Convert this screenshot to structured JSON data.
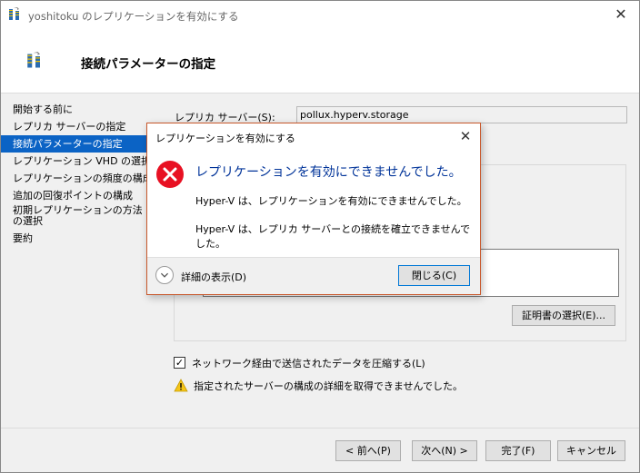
{
  "window": {
    "title": "yoshitoku のレプリケーションを有効にする",
    "close_glyph": "✕"
  },
  "header": {
    "title": "接続パラメーターの指定"
  },
  "nav": {
    "items": [
      {
        "label": "開始する前に"
      },
      {
        "label": "レプリカ サーバーの指定"
      },
      {
        "label": "接続パラメーターの指定"
      },
      {
        "label": "レプリケーション VHD の選択"
      },
      {
        "label": "レプリケーションの頻度の構成"
      },
      {
        "label": "追加の回復ポイントの構成"
      },
      {
        "label": "初期レプリケーションの方法の選択"
      },
      {
        "label": "要約"
      }
    ],
    "selected_index": 2
  },
  "content": {
    "replica_server_label": "レプリカ サーバー(S):",
    "replica_server_value": "pollux.hyperv.storage",
    "cert_button": "証明書の選択(E)...",
    "compress_checked": true,
    "compress_label": "ネットワーク経由で送信されたデータを圧縮する(L)",
    "warning_text": "指定されたサーバーの構成の詳細を取得できませんでした。"
  },
  "footer": {
    "prev": "< 前へ(P)",
    "next": "次へ(N) >",
    "finish": "完了(F)",
    "cancel": "キャンセル"
  },
  "dialog": {
    "title": "レプリケーションを有効にする",
    "close_glyph": "✕",
    "main": "レプリケーションを有効にできませんでした。",
    "line1": "Hyper-V は、レプリケーションを有効にできませんでした。",
    "line2": "Hyper-V は、レプリカ サーバーとの接続を確立できませんでした。",
    "details": "詳細の表示(D)",
    "close_button": "閉じる(C)"
  },
  "colors": {
    "selection": "#0b63c5",
    "error_icon": "#e81123",
    "dialog_border": "#c8582c",
    "main_instruction": "#003399",
    "warning_icon": "#f5c518"
  }
}
